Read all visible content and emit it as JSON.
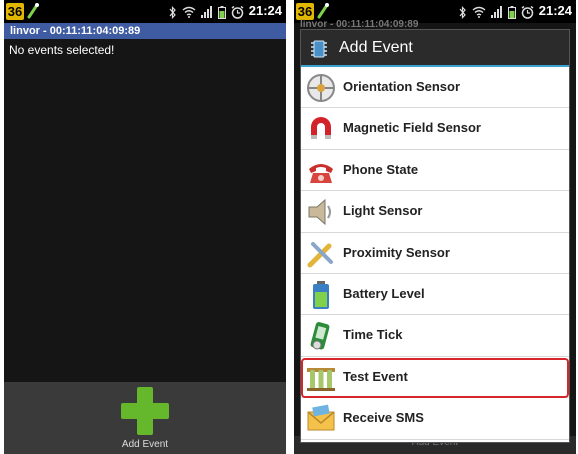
{
  "left_screen": {
    "status": {
      "badge": "36",
      "time": "21:24"
    },
    "title_bar": "linvor - 00:11:11:04:09:89",
    "empty_message": "No events selected!",
    "add_button_label": "Add Event"
  },
  "right_screen": {
    "status": {
      "badge": "36",
      "time": "21:24"
    },
    "title_bar": "linvor - 00:11:11:04:09:89",
    "bottom_label": "Add Event",
    "dialog": {
      "title": "Add Event",
      "items": [
        {
          "label": "Orientation Sensor",
          "icon": "orientation-sensor-icon"
        },
        {
          "label": "Magnetic Field Sensor",
          "icon": "magnet-icon"
        },
        {
          "label": "Phone State",
          "icon": "telephone-icon"
        },
        {
          "label": "Light Sensor",
          "icon": "light-bulb-icon"
        },
        {
          "label": "Proximity Sensor",
          "icon": "proximity-sensor-icon"
        },
        {
          "label": "Battery Level",
          "icon": "battery-icon"
        },
        {
          "label": "Time Tick",
          "icon": "clock-phone-icon"
        },
        {
          "label": "Test Event",
          "icon": "test-tubes-icon",
          "highlighted": true
        },
        {
          "label": "Receive SMS",
          "icon": "envelope-icon"
        }
      ]
    }
  },
  "colors": {
    "title_bar": "#3f5ca3",
    "plus_green": "#65b82c",
    "highlight_red": "#d7262b",
    "dialog_accent": "#3aa2d0",
    "badge_yellow": "#e2b700"
  }
}
